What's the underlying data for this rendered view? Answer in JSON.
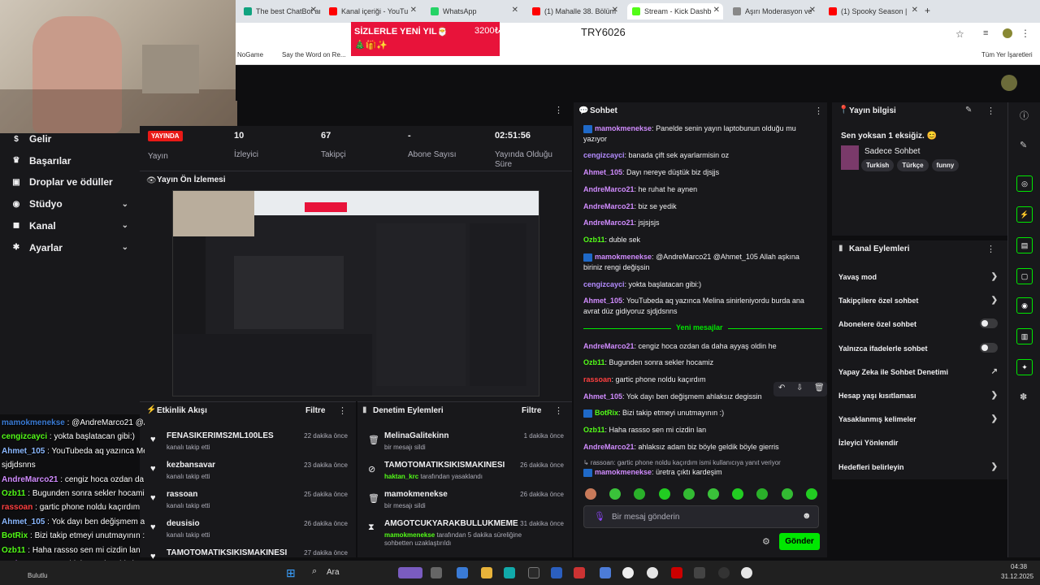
{
  "browser": {
    "tabs": [
      {
        "label": "The best ChatBot an",
        "color": "#10a37f",
        "active": false
      },
      {
        "label": "Kanal içeriği - YouTu",
        "color": "#ff0000",
        "active": false
      },
      {
        "label": "WhatsApp",
        "color": "#25d366",
        "active": false
      },
      {
        "label": "(1) Mahalle 38. Bölüm",
        "color": "#ff0000",
        "active": false
      },
      {
        "label": "Stream - Kick Dashb",
        "color": "#53fc18",
        "active": true
      },
      {
        "label": "Aşırı Moderasyon ve",
        "color": "#888888",
        "active": false
      },
      {
        "label": "(1) Spooky Season | ",
        "color": "#ff0000",
        "active": false
      }
    ],
    "bookmarks": [
      "NoGame",
      "Say the Word on Re..."
    ],
    "bookmarks_right": "Tüm Yer İşaretleri"
  },
  "overlay": {
    "donation_text": "SİZLERLE YENİ YIL🎅🎄🎁✨",
    "donation_amount": "3200₺",
    "donation_code": "TRY6026"
  },
  "sidebar": {
    "items": [
      {
        "label": "Gelir",
        "icon": "dollar-icon",
        "glyph": "$"
      },
      {
        "label": "Başarılar",
        "icon": "trophy-icon",
        "glyph": "♛"
      },
      {
        "label": "Droplar ve ödüller",
        "icon": "gift-icon",
        "glyph": "▣"
      },
      {
        "label": "Stüdyo",
        "icon": "studio-icon",
        "glyph": "◉",
        "expand": true
      },
      {
        "label": "Kanal",
        "icon": "channel-icon",
        "glyph": "◼",
        "expand": true
      },
      {
        "label": "Ayarlar",
        "icon": "settings-icon",
        "glyph": "✱",
        "expand": true
      }
    ]
  },
  "stats": {
    "live_badge": "YAYINDA",
    "stream_label": "Yayın",
    "viewers_value": "10",
    "viewers_label": "İzleyici",
    "followers_value": "67",
    "followers_label": "Takipçi",
    "subs_value": "-",
    "subs_label": "Abone Sayısı",
    "time_value": "02:51:56",
    "time_label": "Yayında Olduğu Süre"
  },
  "preview": {
    "title": "Yayın Ön İzlemesi"
  },
  "activity": {
    "title": "Etkinlik Akışı",
    "filter": "Filtre",
    "rows": [
      {
        "name": "FENASIKERIMS2ML100LES",
        "sub": "kanalı takip etti",
        "time": "22 dakika önce"
      },
      {
        "name": "kezbansavar",
        "sub": "kanalı takip etti",
        "time": "23 dakika önce"
      },
      {
        "name": "rassoan",
        "sub": "kanalı takip etti",
        "time": "25 dakika önce"
      },
      {
        "name": "deusisio",
        "sub": "kanalı takip etti",
        "time": "26 dakika önce"
      },
      {
        "name": "TAMOTOMATIKSIKISMAKINESI",
        "sub": "",
        "time": "27 dakika önce"
      }
    ]
  },
  "moderation": {
    "title": "Denetim Eylemleri",
    "filter": "Filtre",
    "rows": [
      {
        "name": "MelinaGalitekinn",
        "sub_user": "",
        "sub": "bir mesajı sildi",
        "time": "1 dakika önce",
        "glyph": "🗑"
      },
      {
        "name": "TAMOTOMATIKSIKISMAKINESI",
        "sub_user": "haktan_krc",
        "sub": "tarafından yasaklandı",
        "time": "26 dakika önce",
        "glyph": "⊘"
      },
      {
        "name": "mamokmenekse",
        "sub_user": "",
        "sub": "bir mesajı sildi",
        "time": "26 dakika önce",
        "glyph": "🗑"
      },
      {
        "name": "AMGOTCUKYARAKBULLUKMEME",
        "sub_user": "mamokmenekse",
        "sub": "tarafından 5 dakika süreliğine sohbetten uzaklaştırıldı",
        "time": "31 dakika önce",
        "glyph": "⧗"
      }
    ]
  },
  "overlay_chat": [
    {
      "user": "mamokmenekse",
      "text": "@AndreMarco21 @Ahmet_105 Allah aşkına biriniz rengi değişsin",
      "color": "#3a7bd5"
    },
    {
      "user": "cengizcayci",
      "text": "yokta başlatacan gibi:)",
      "color": "#53fc18"
    },
    {
      "user": "Ahmet_105",
      "text": "YouTubeda aq yazınca Melina sinirleniyordu burda ana avrat düz gidiyoruz",
      "color": "#8bb8ff"
    },
    {
      "user": "",
      "text": "sjdjdsnns",
      "color": "#fff"
    },
    {
      "user": "AndreMarco21",
      "text": "cengiz hoca ozdan da daha ayyaş oldin he",
      "color": "#d18cff"
    },
    {
      "user": "Ozb11",
      "text": "Bugunden sonra sekler hocamiz",
      "color": "#53fc18"
    },
    {
      "user": "rassoan",
      "text": "gartic phone noldu kaçırdım",
      "color": "#ff4040"
    },
    {
      "user": "Ahmet_105",
      "text": "Yok dayı ben değişmem ahlaksız değisio",
      "color": "#8bb8ff"
    },
    {
      "user": "BotRix",
      "text": "Bizi takip etmeyi unutmayının :)",
      "color": "#53fc18"
    },
    {
      "user": "Ozb11",
      "text": "Haha rassso sen mi cizdin lan",
      "color": "#53fc18"
    },
    {
      "user": "AndreMarco21",
      "text": "ahlaksız adam biz böyle geldik böyle gierris",
      "color": "#d18cff"
    }
  ],
  "chat": {
    "title": "Sohbet",
    "new_messages": "Yeni mesajlar",
    "input_placeholder": "Bir mesaj gönderin",
    "send": "Gönder",
    "messages": [
      {
        "user": "mamokmenekse",
        "text": "Panelde senin yayın laptobunun olduğu mu yazıyor",
        "color": "#d18cff",
        "badge": true
      },
      {
        "user": "cengizcayci",
        "text": "banada çift sek ayarlarmisin oz",
        "color": "#b48cff",
        "badge": false
      },
      {
        "user": "Ahmet_105",
        "text": "Dayı nereye düştük biz djsjjs",
        "color": "#d18cff",
        "badge": false
      },
      {
        "user": "AndreMarco21",
        "text": "he ruhat he aynen",
        "color": "#d18cff",
        "badge": false
      },
      {
        "user": "AndreMarco21",
        "text": "biz se yedik",
        "color": "#d18cff",
        "badge": false
      },
      {
        "user": "AndreMarco21",
        "text": "jsjsjsjs",
        "color": "#d18cff",
        "badge": false
      },
      {
        "user": "Ozb11",
        "text": "duble sek",
        "color": "#53fc18",
        "badge": false
      },
      {
        "user": "mamokmenekse",
        "text": "@AndreMarco21 @Ahmet_105 Allah aşkına biriniz rengi değişsin",
        "color": "#d18cff",
        "badge": true
      },
      {
        "user": "cengizcayci",
        "text": "yokta başlatacan gibi:)",
        "color": "#b48cff",
        "badge": false
      },
      {
        "user": "Ahmet_105",
        "text": "YouTubeda aq yazınca Melina sinirleniyordu burda ana avrat düz gidiyoruz sjdjdsnns",
        "color": "#d18cff",
        "badge": false
      },
      {
        "user": "AndreMarco21",
        "text": "cengiz hoca ozdan da daha ayyaş oldin he",
        "color": "#d18cff",
        "badge": false
      },
      {
        "user": "Ozb11",
        "text": "Bugunden sonra sekler hocamiz",
        "color": "#53fc18",
        "badge": false
      },
      {
        "user": "rassoan",
        "text": "gartic phone noldu kaçırdım",
        "color": "#ff4040",
        "badge": false
      },
      {
        "user": "Ahmet_105",
        "text": "Yok dayı ben değişmem ahlaksız degissin",
        "color": "#d18cff",
        "badge": false
      },
      {
        "user": "BotRix",
        "text": "Bizi takip etmeyi unutmayının :)",
        "color": "#53fc18",
        "badge": true
      },
      {
        "user": "Ozb11",
        "text": "Haha rassso sen mi cizdin lan",
        "color": "#53fc18",
        "badge": false
      },
      {
        "user": "AndreMarco21",
        "text": "ahlaksız adam biz böyle geldik böyle gierris",
        "color": "#d18cff",
        "badge": false
      },
      {
        "user": "",
        "text": "↳ rassoan: gartic phone noldu kaçırdım ismi kullanıcıya yanıt veriyor",
        "color": "#adadb8",
        "badge": false
      },
      {
        "user": "mamokmenekse",
        "text": "üretra çıktı kardeşim",
        "color": "#d18cff",
        "badge": true
      }
    ]
  },
  "stream_info": {
    "title": "Yayın bilgisi",
    "stream_title": "Sen yoksan 1 eksiğiz. 😊",
    "category": "Sadece Sohbet",
    "tags": [
      "Turkish",
      "Türkçe",
      "funny"
    ]
  },
  "channel_actions": {
    "title": "Kanal Eylemleri",
    "items": [
      {
        "label": "Yavaş mod",
        "control": "chevron"
      },
      {
        "label": "Takipçilere özel sohbet",
        "control": "chevron"
      },
      {
        "label": "Abonelere özel sohbet",
        "control": "toggle"
      },
      {
        "label": "Yalnızca ifadelerle sohbet",
        "control": "toggle"
      },
      {
        "label": "Yapay Zeka ile Sohbet Denetimi",
        "control": "external"
      },
      {
        "label": "Hesap yaşı kısıtlaması",
        "control": "chevron"
      },
      {
        "label": "Yasaklanmış kelimeler",
        "control": "chevron"
      },
      {
        "label": "İzleyici Yönlendir",
        "control": "none"
      },
      {
        "label": "Hedefleri belirleyin",
        "control": "chevron"
      }
    ]
  },
  "taskbar": {
    "search": "Ara",
    "weather": "Bulutlu",
    "time": "04:38",
    "date": "31.12.2025"
  }
}
